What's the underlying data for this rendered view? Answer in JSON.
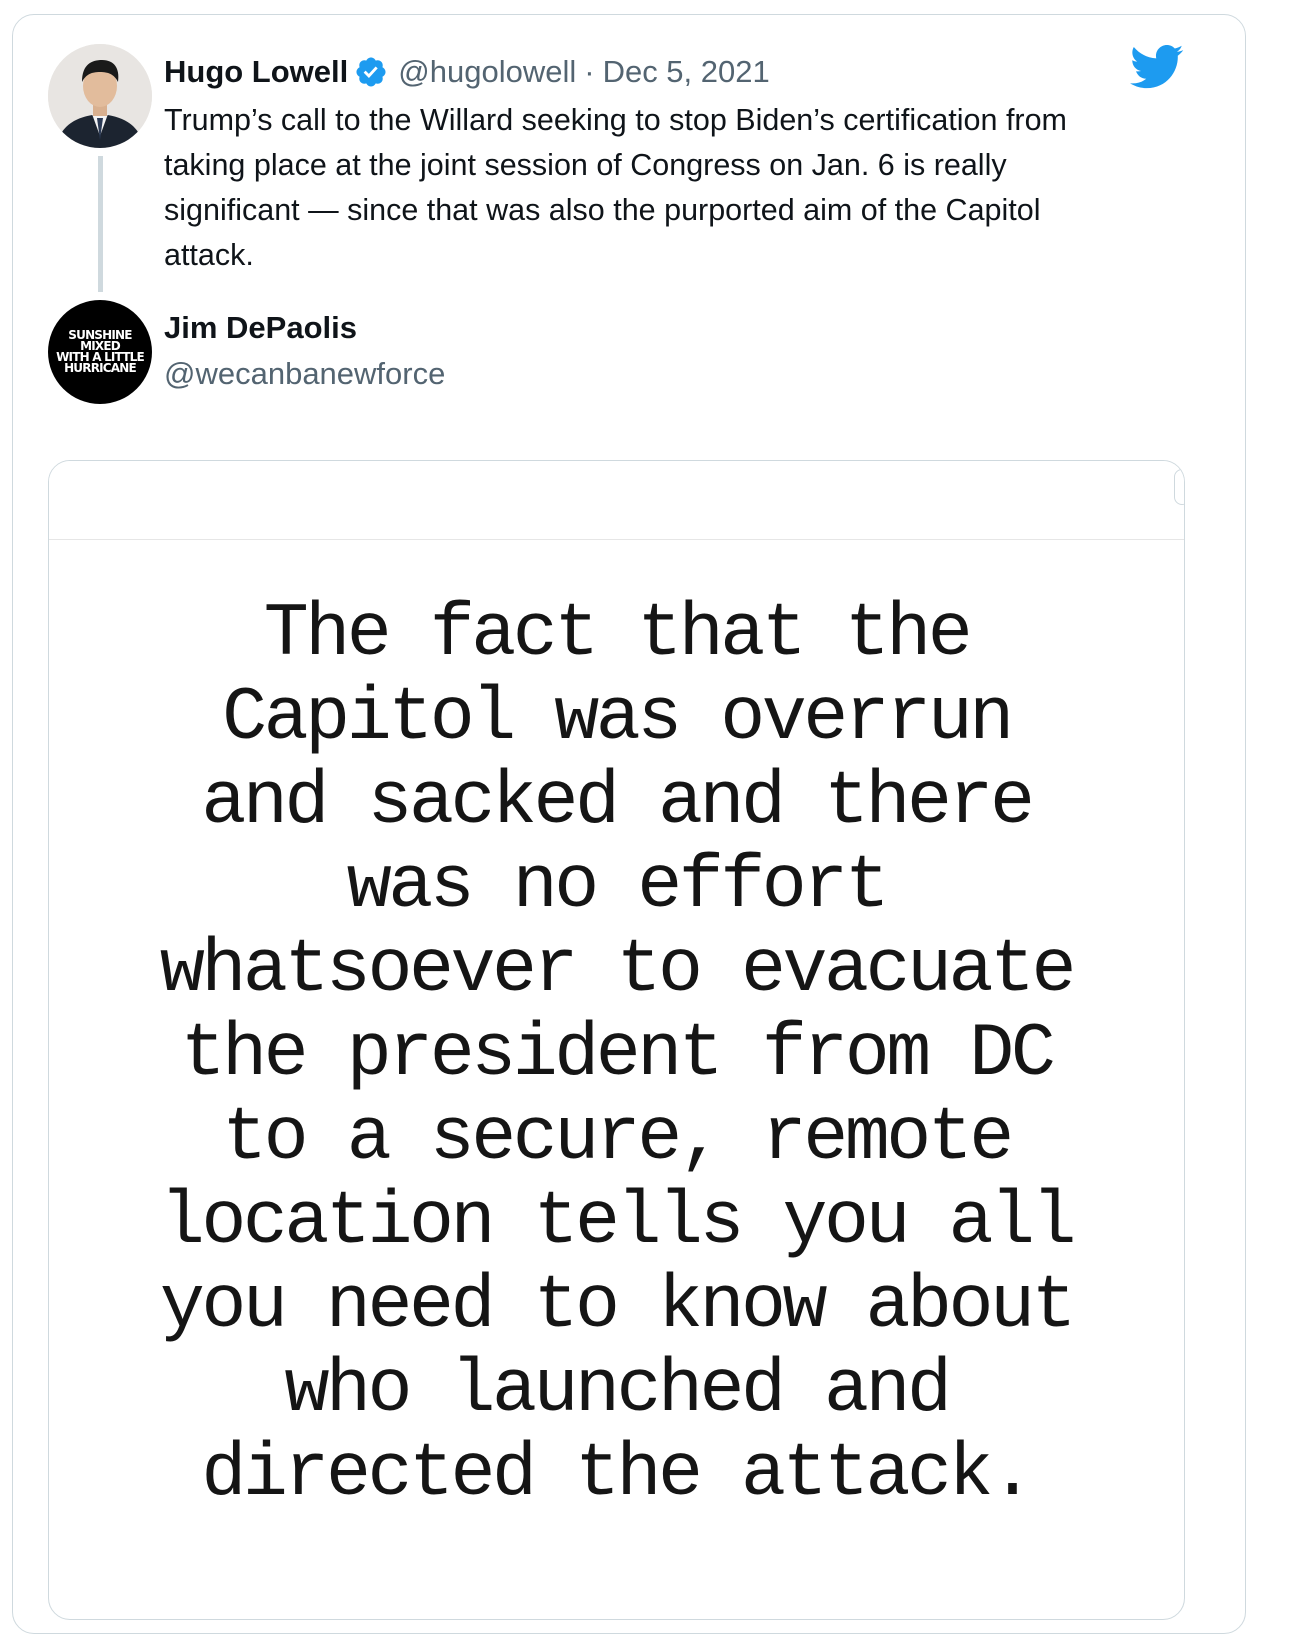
{
  "tweet": {
    "author_name": "Hugo Lowell",
    "author_handle": "@hugolowell",
    "separator": "·",
    "date": "Dec 5, 2021",
    "text": "Trump’s call to the Willard seeking to stop Biden’s certification from\ntaking place at the joint session of Congress on Jan. 6 is really\nsignificant — since that was also the purported aim of the Capitol\nattack."
  },
  "quoted": {
    "author_name": "Jim DePaolis",
    "author_handle": "@wecanbanewforce",
    "avatar_text": [
      "SUNSHINE MIXED",
      "WITH A LITTLE",
      "HURRICANE"
    ],
    "image_text": "The fact that the\nCapitol was overrun\nand sacked and there\nwas no effort\nwhatsoever to evacuate\nthe president from DC\nto a secure, remote\nlocation tells you all\nyou need to know about\nwho launched and\ndirected the attack."
  },
  "icons": {
    "verified": "verified-badge-icon",
    "brand": "twitter-bird-icon"
  },
  "colors": {
    "twitter_blue": "#1d9bf0",
    "text_primary": "#0f1419",
    "text_secondary": "#536471",
    "border": "#cfd9de"
  }
}
